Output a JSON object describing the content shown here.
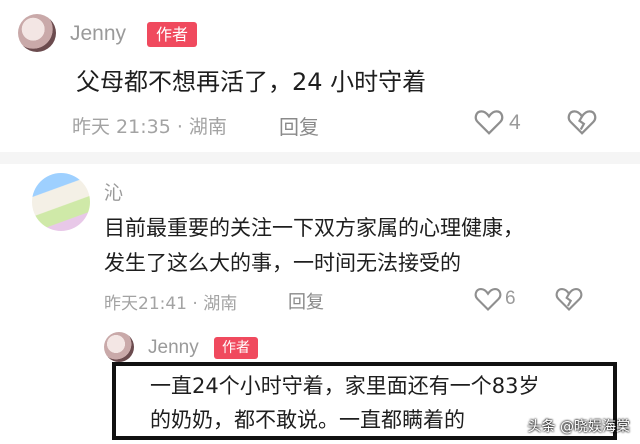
{
  "comments": [
    {
      "author": "Jenny",
      "badge": "作者",
      "text": "父母都不想再活了，24 小时守着",
      "time_location": "昨天 21:35 · 湖南",
      "reply_label": "回复",
      "likes": "4"
    },
    {
      "author": "沁",
      "text_line1": "目前最重要的关注一下双方家属的心理健康，",
      "text_line2": "发生了这么大的事，一时间无法接受的",
      "time_location": "昨天21:41 · 湖南",
      "reply_label": "回复",
      "likes": "6"
    },
    {
      "author": "Jenny",
      "badge": "作者",
      "text_line1": "一直24个小时守着，家里面还有一个83岁",
      "text_line2": "的奶奶，都不敢说。一直都瞒着的"
    }
  ],
  "watermark": "头条 @晓娱海棠",
  "colors": {
    "badge": "#f04a5e",
    "meta": "#a3a3a3",
    "text": "#1e1e1e"
  },
  "icons": [
    "heart-outline-icon",
    "broken-heart-icon"
  ]
}
